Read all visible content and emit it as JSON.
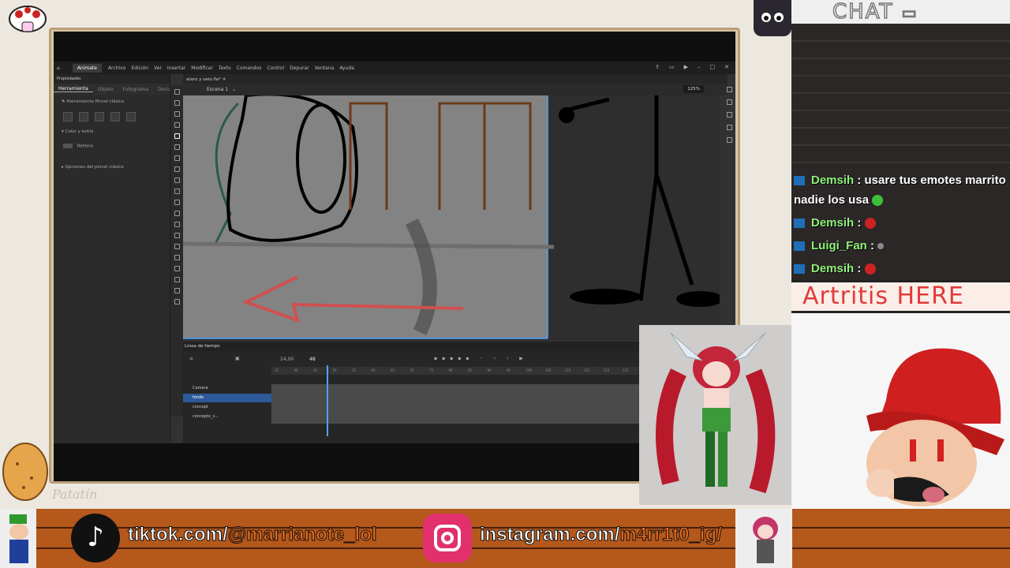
{
  "app": {
    "badge": "Animate",
    "menu": [
      "Archivo",
      "Edición",
      "Ver",
      "Insertar",
      "Modificar",
      "Texto",
      "Comandos",
      "Control",
      "Depurar",
      "Ventana",
      "Ayuda"
    ]
  },
  "properties": {
    "header": "Propiedades",
    "tabs": [
      "Herramienta",
      "Objeto",
      "Fotograma",
      "Documen"
    ],
    "tool_name": "Herramienta Pincel clásico",
    "section_color": "Color y estilo",
    "fill_label": "Relleno",
    "section_brush": "Opciones del pincel clásico"
  },
  "document": {
    "tab": "ataro y oeio.fla*",
    "scene": "Escena 1",
    "zoom": "125%"
  },
  "timeline": {
    "title": "Línea de tiempo",
    "fps": "24,00",
    "frame": "48",
    "ruler_ticks": [
      "35",
      "40",
      "45",
      "50",
      "55",
      "60",
      "65",
      "70",
      "75",
      "80",
      "85",
      "90",
      "95",
      "100",
      "105",
      "110",
      "115",
      "120",
      "125"
    ],
    "layers": [
      "Camera",
      "fondo",
      "concept",
      "concepto_s..."
    ]
  },
  "chat": {
    "title": "CHAT",
    "messages": [
      {
        "user": "Demsih",
        "text": " : usare tus emotes marrito nadie los usa",
        "emote_color": "#3cbf3c"
      },
      {
        "user": "Demsih",
        "text": " :",
        "emote_color": "#cc2222"
      },
      {
        "user": "Luigi_Fan",
        "text": " :",
        "emote_color": "#888888"
      },
      {
        "user": "Demsih",
        "text": " :",
        "emote_color": "#cc2222"
      }
    ]
  },
  "banner": "Artritis HERE",
  "socials": {
    "tiktok_prefix": "tiktok.com/",
    "tiktok_handle": "@marrianote_lol",
    "insta_prefix": "instagram.com/",
    "insta_handle": "m4rr1t0_ig/"
  },
  "footer_label": "Patatín",
  "colors": {
    "accent_blue": "#4da3ff",
    "chat_user": "#8ff07a",
    "banner_red": "#e13a3a",
    "brick": "#b4581c"
  }
}
